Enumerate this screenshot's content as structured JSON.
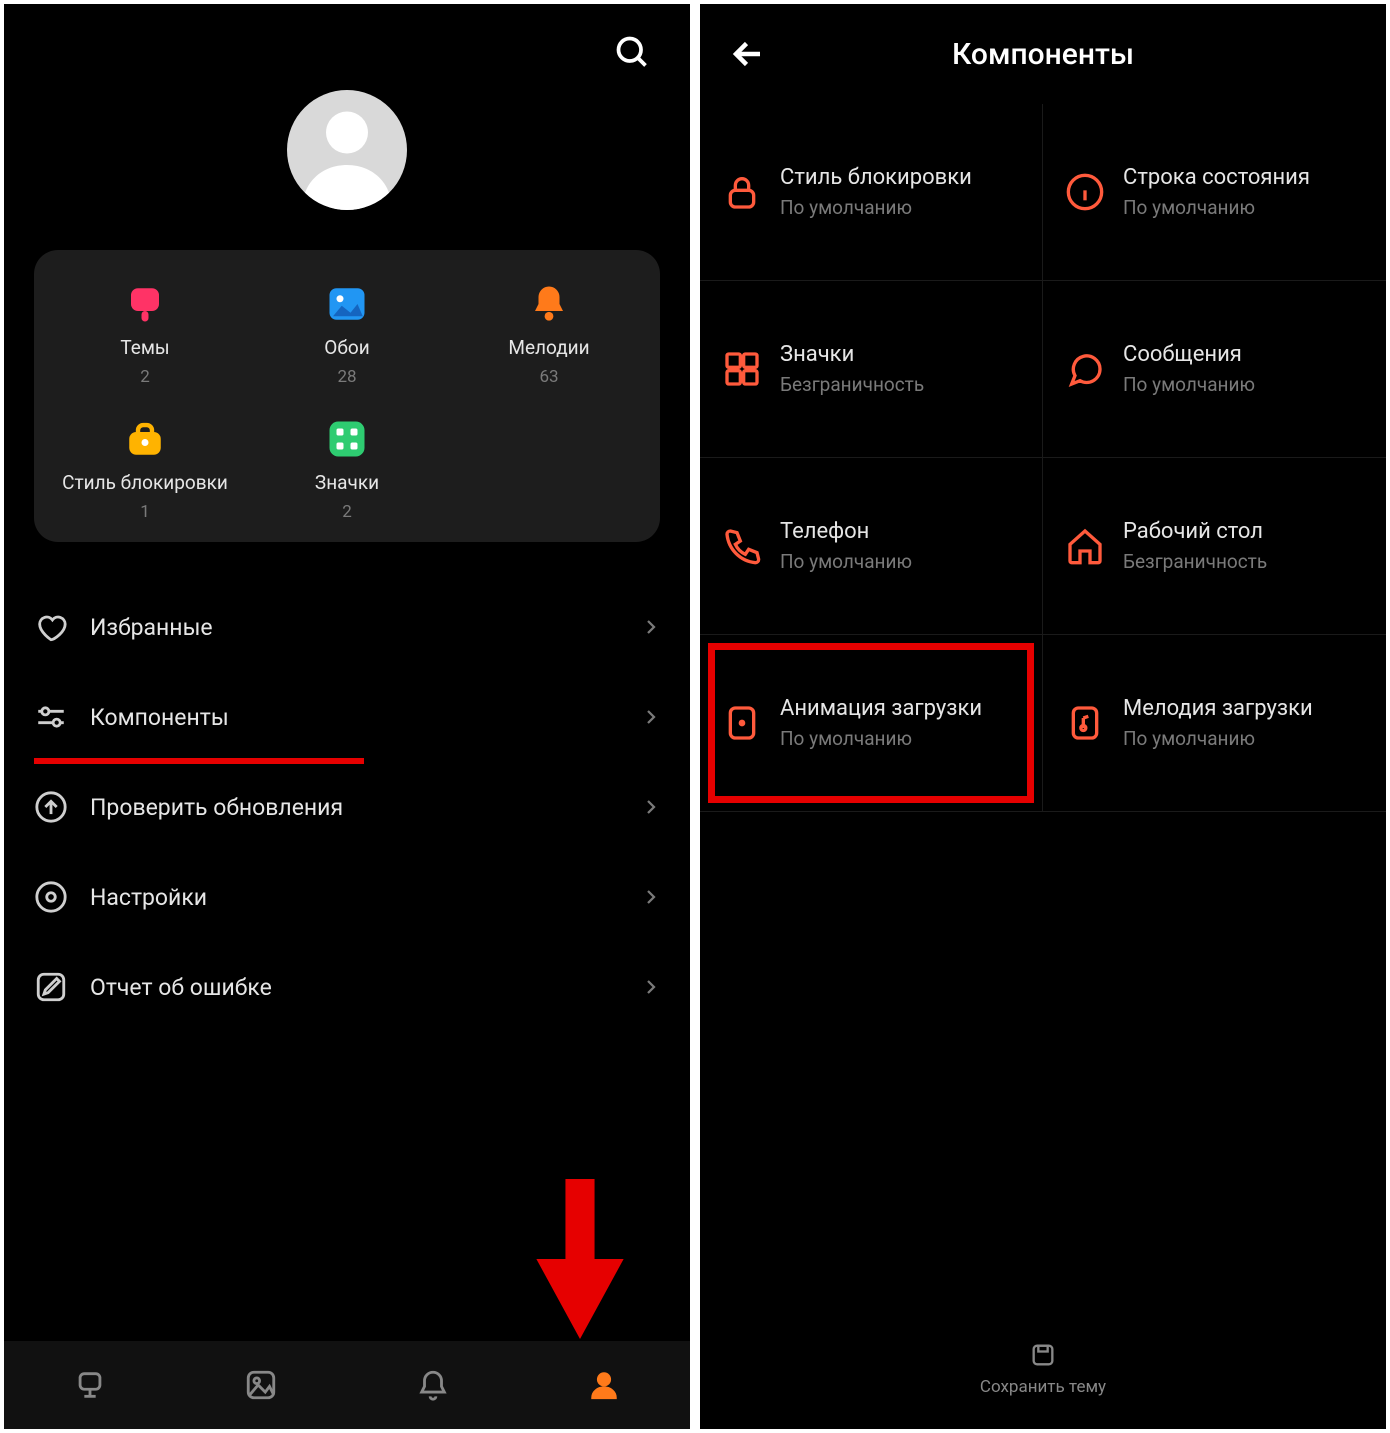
{
  "left": {
    "grid": [
      {
        "label": "Темы",
        "count": "2",
        "icon": "themes"
      },
      {
        "label": "Обои",
        "count": "28",
        "icon": "wallpaper"
      },
      {
        "label": "Мелодии",
        "count": "63",
        "icon": "ringtone"
      },
      {
        "label": "Стиль блокировки",
        "count": "1",
        "icon": "lockstyle"
      },
      {
        "label": "Значки",
        "count": "2",
        "icon": "icons"
      }
    ],
    "menu": [
      {
        "label": "Избранные",
        "icon": "heart"
      },
      {
        "label": "Компоненты",
        "icon": "sliders",
        "highlight": true
      },
      {
        "label": "Проверить обновления",
        "icon": "arrow-up-circle"
      },
      {
        "label": "Настройки",
        "icon": "target"
      },
      {
        "label": "Отчет об ошибке",
        "icon": "edit"
      }
    ]
  },
  "right": {
    "title": "Компоненты",
    "save": "Сохранить тему",
    "cells": [
      {
        "title": "Стиль блокировки",
        "sub": "По умолчанию",
        "icon": "lock"
      },
      {
        "title": "Строка состояния",
        "sub": "По умолчанию",
        "icon": "info"
      },
      {
        "title": "Значки",
        "sub": "Безграничность",
        "icon": "grid4"
      },
      {
        "title": "Сообщения",
        "sub": "По умолчанию",
        "icon": "chat"
      },
      {
        "title": "Телефон",
        "sub": "По умолчанию",
        "icon": "phone"
      },
      {
        "title": "Рабочий стол",
        "sub": "Безграничность",
        "icon": "home"
      },
      {
        "title": "Анимация загрузки",
        "sub": "По умолчанию",
        "icon": "boot-anim",
        "highlight": true
      },
      {
        "title": "Мелодия загрузки",
        "sub": "По умолчанию",
        "icon": "boot-sound"
      }
    ]
  }
}
